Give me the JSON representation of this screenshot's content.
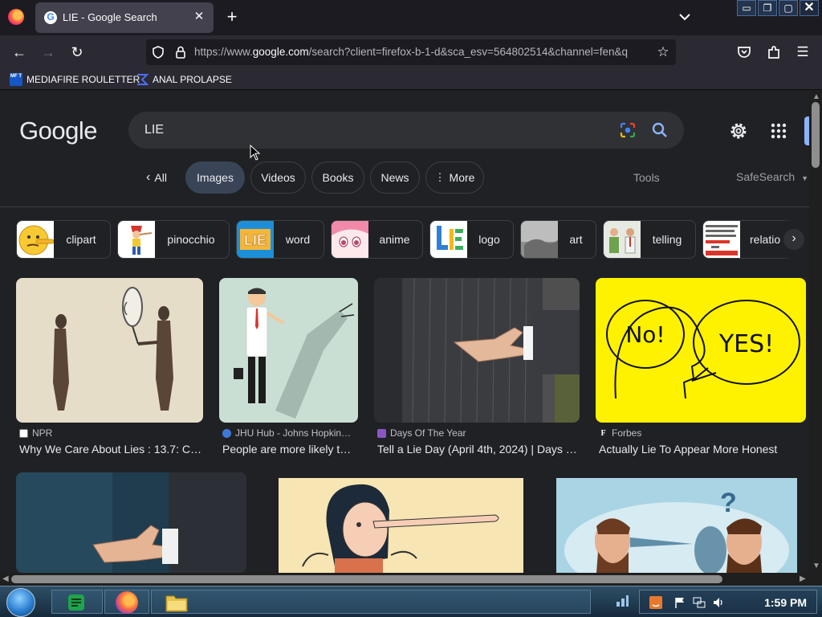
{
  "browser": {
    "tab": {
      "title": "LIE - Google Search"
    },
    "url": {
      "prefix": "https://www.",
      "domain": "google.com",
      "rest": "/search?client=firefox-b-1-d&sca_esv=564802514&channel=fen&q"
    },
    "bookmarks": [
      {
        "label": "MEDIAFIRE ROULETTER",
        "icon": "MF T"
      },
      {
        "label": "ANAL PROLAPSE"
      }
    ],
    "window_controls": [
      "_",
      "□",
      "X"
    ]
  },
  "google": {
    "logo": "Google",
    "query": "LIE",
    "filters": [
      {
        "label": "All",
        "type": "back"
      },
      {
        "label": "Images",
        "active": true
      },
      {
        "label": "Videos"
      },
      {
        "label": "Books"
      },
      {
        "label": "News"
      },
      {
        "label": "More",
        "type": "more"
      }
    ],
    "tools": "Tools",
    "safesearch": "SafeSearch",
    "related": [
      {
        "label": "clipart"
      },
      {
        "label": "pinocchio"
      },
      {
        "label": "word"
      },
      {
        "label": "anime"
      },
      {
        "label": "logo"
      },
      {
        "label": "art"
      },
      {
        "label": "telling"
      },
      {
        "label": "relatio"
      }
    ],
    "results_row1": [
      {
        "source": "NPR",
        "title": "Why We Care About Lies : 13.7: C…",
        "source_color": "#3b5998"
      },
      {
        "source": "JHU Hub - Johns Hopkin…",
        "title": "People are more likely t…",
        "source_color": "#3d79d6"
      },
      {
        "source": "Days Of The Year",
        "title": "Tell a Lie Day (April 4th, 2024) | Days …",
        "source_color": "#8a56c2"
      },
      {
        "source": "Forbes",
        "title": "Actually Lie To Appear More Honest",
        "source_color": "#ffffff"
      }
    ],
    "result_images_row1": {
      "forbes_bubble_left": "No!",
      "forbes_bubble_right": "YES!"
    }
  },
  "taskbar": {
    "clock": "1:59 PM"
  }
}
